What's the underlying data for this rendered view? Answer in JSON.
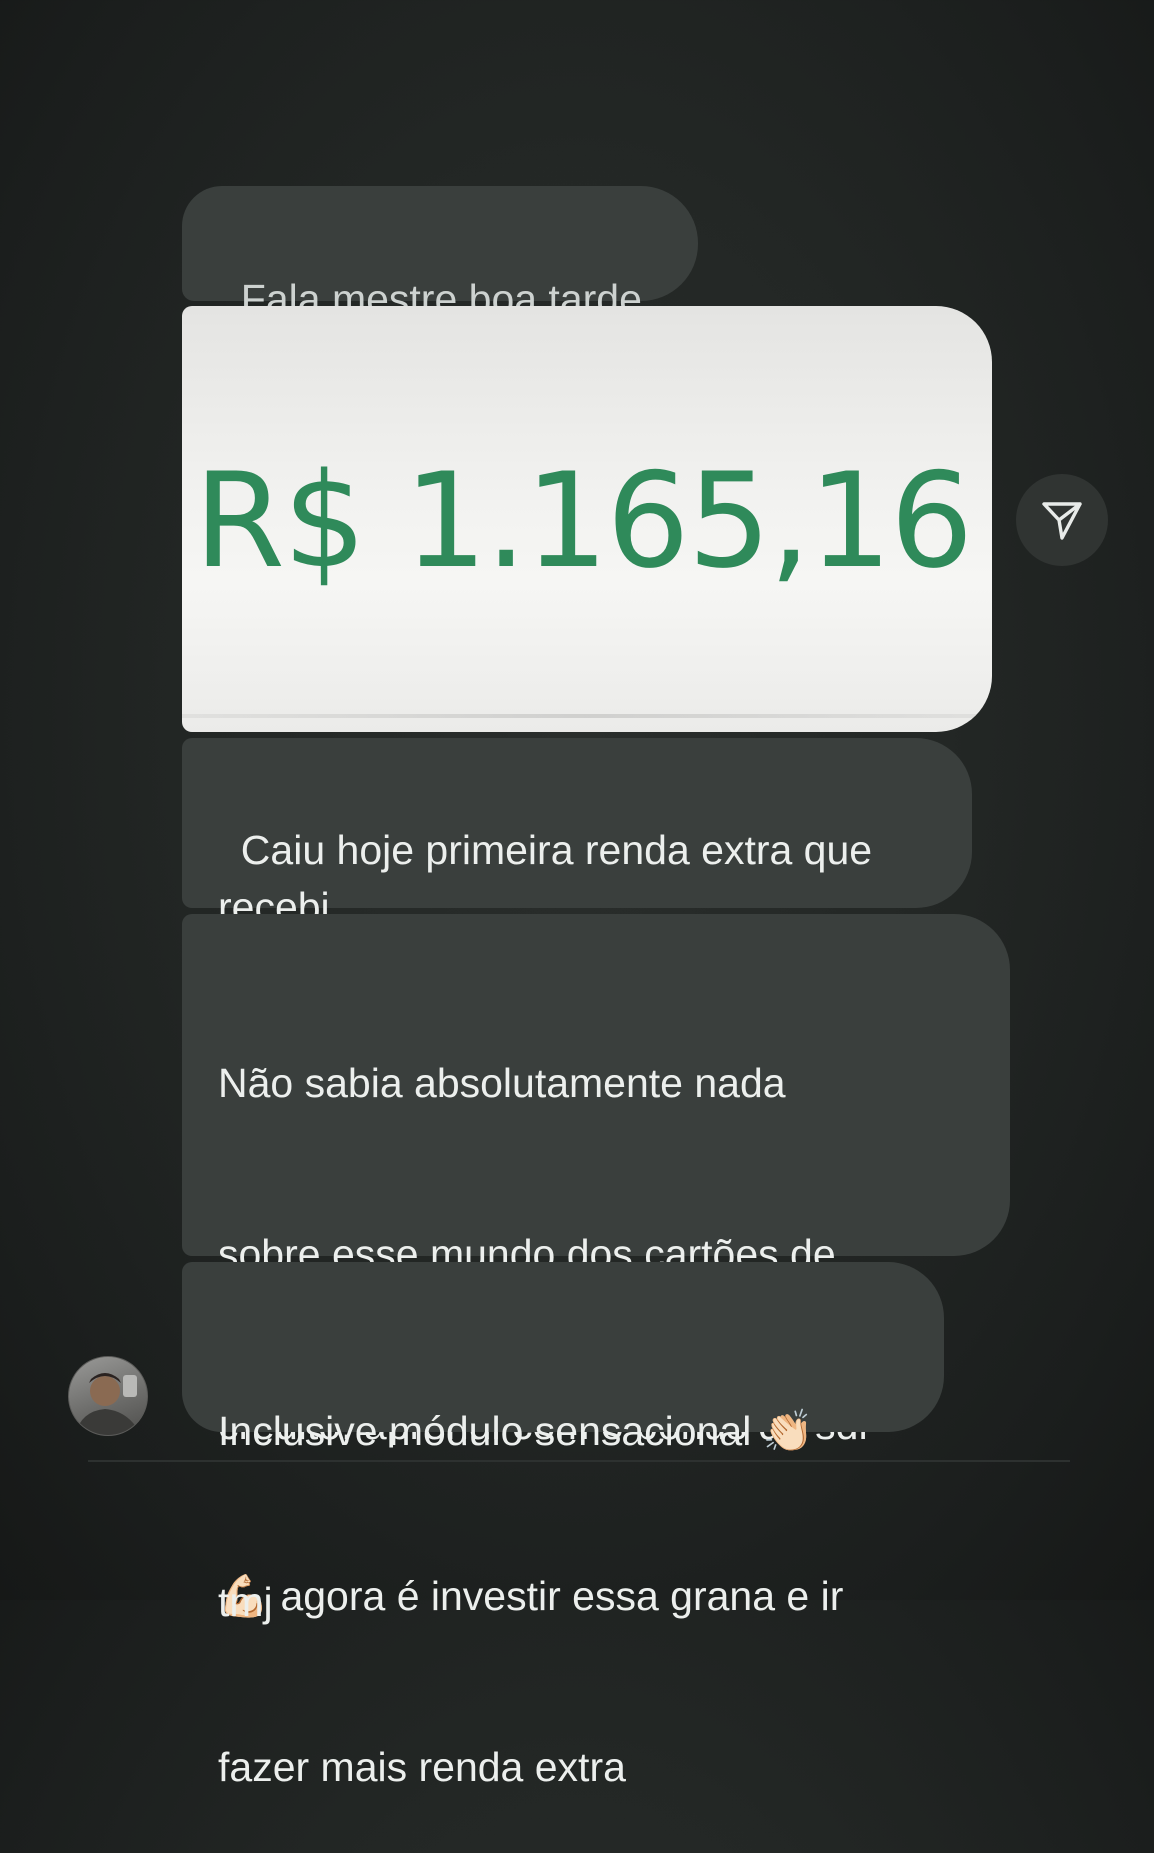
{
  "messages": [
    {
      "text": "Fala mestre boa tarde"
    },
    {
      "image_amount": "R$ 1.165,16"
    },
    {
      "text": "Caiu hoje primeira renda extra que\nrecebi"
    },
    {
      "line1": "Não sabia absolutamente nada",
      "line2": "sobre esse mundo dos cartões de",
      "line3": "crédito, aprendi com o bônus da sdr",
      "emoji": "💪🏻",
      "line4_rest": " agora é investir essa grana e ir",
      "line5": "fazer mais renda extra"
    },
    {
      "line1_text": "Inclusive módulo sensacional ",
      "emoji": "👏🏻",
      "line2": "tmj"
    }
  ],
  "icons": {
    "share": "paper-plane-icon",
    "avatar": "sender-avatar"
  },
  "colors": {
    "background": "#232725",
    "bubble": "#3a3f3d",
    "amount_green": "#2f8a5a",
    "text": "#ecefed"
  }
}
